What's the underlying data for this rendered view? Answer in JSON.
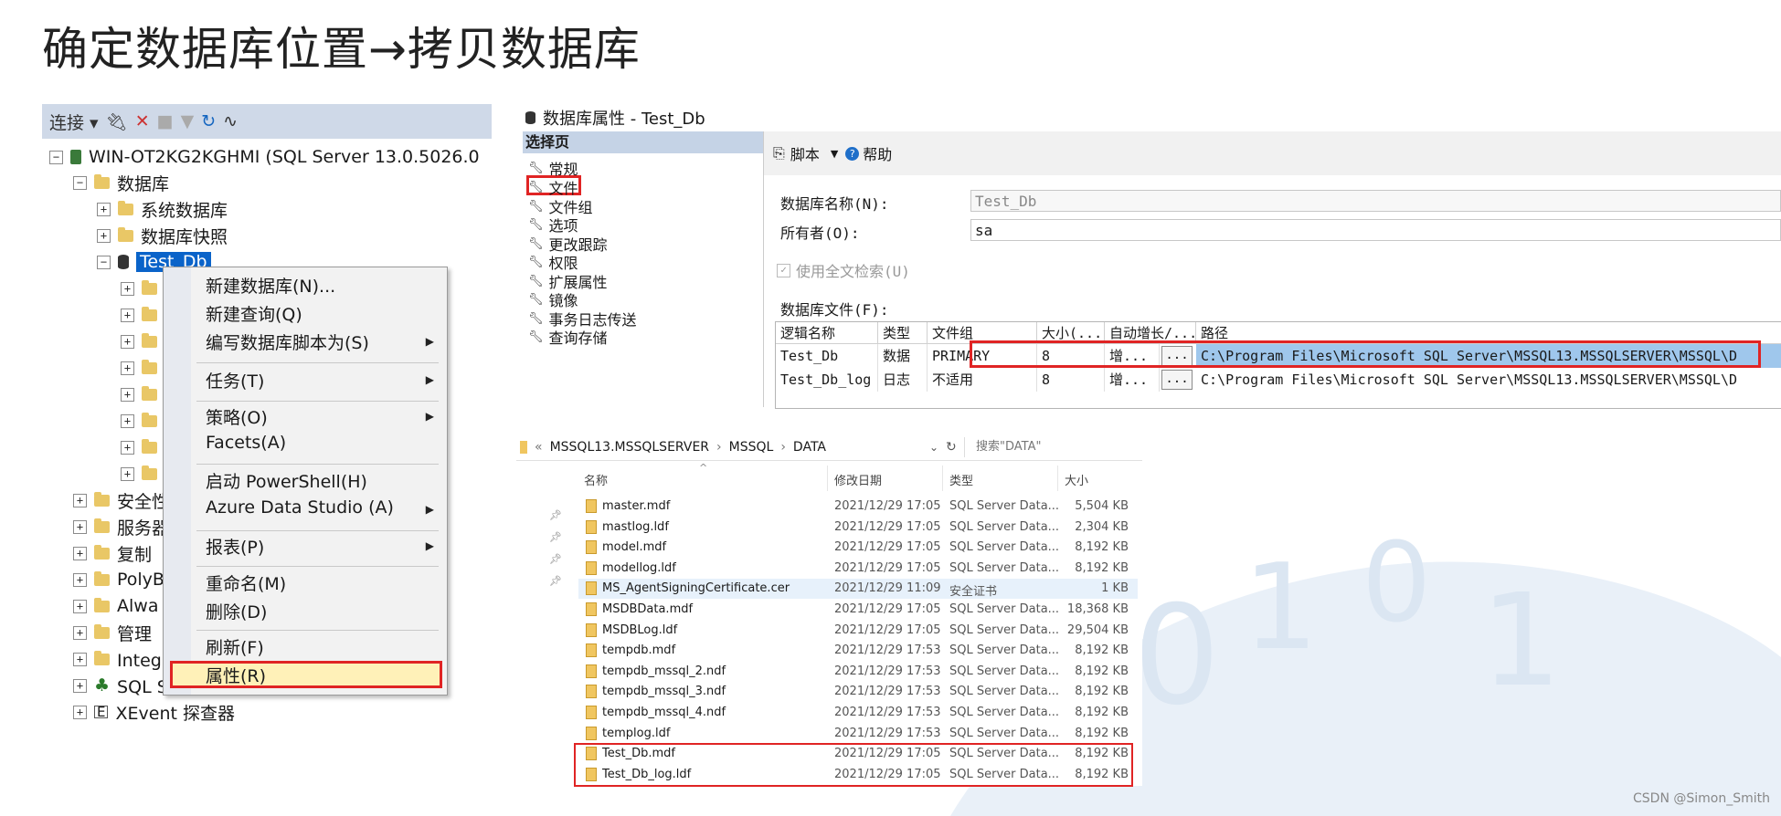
{
  "slide": {
    "title": "确定数据库位置→拷贝数据库",
    "footer": "CSDN @Simon_Smith"
  },
  "object_explorer": {
    "toolbar": {
      "connect_label": "连接 ▾",
      "icons": [
        "plug-icon",
        "disconnect-icon",
        "stop-icon",
        "filter-icon",
        "refresh-icon",
        "activity-icon"
      ]
    },
    "server": "WIN-OT2KG2KGHMI (SQL Server 13.0.5026.0",
    "databases": "数据库",
    "system_databases": "系统数据库",
    "db_snapshots": "数据库快照",
    "test_db": "Test_Db",
    "partial_items": [
      "安全性",
      "服务器",
      "复制",
      "PolyB",
      "Alwa",
      "管理"
    ],
    "integration": "Integration Services 目录",
    "agent": "SQL Server 代理",
    "xevent": "XEvent 探查器"
  },
  "context_menu": {
    "items": [
      {
        "label": "新建数据库(N)...",
        "submenu": false
      },
      {
        "label": "新建查询(Q)",
        "submenu": false
      },
      {
        "label": "编写数据库脚本为(S)",
        "submenu": true
      },
      {
        "label": "任务(T)",
        "submenu": true
      },
      {
        "label": "策略(O)",
        "submenu": true
      },
      {
        "label": "Facets(A)",
        "submenu": false
      },
      {
        "label": "启动 PowerShell(H)",
        "submenu": false
      },
      {
        "label": "Azure Data Studio (A)",
        "submenu": true
      },
      {
        "label": "报表(P)",
        "submenu": true
      },
      {
        "label": "重命名(M)",
        "submenu": false
      },
      {
        "label": "删除(D)",
        "submenu": false
      },
      {
        "label": "刷新(F)",
        "submenu": false
      },
      {
        "label": "属性(R)",
        "submenu": false,
        "highlighted": true
      }
    ]
  },
  "properties_dialog": {
    "title": "数据库属性 - Test_Db",
    "select_page_header": "选择页",
    "pages": [
      "常规",
      "文件",
      "文件组",
      "选项",
      "更改跟踪",
      "权限",
      "扩展属性",
      "镜像",
      "事务日志传送",
      "查询存储"
    ],
    "selected_page": "文件",
    "toolbar": {
      "script": "脚本",
      "help": "帮助"
    },
    "db_name_label": "数据库名称(N):",
    "db_name_value": "Test_Db",
    "owner_label": "所有者(O):",
    "owner_value": "sa",
    "fulltext_label": "使用全文检索(U)",
    "files_label": "数据库文件(F):",
    "grid": {
      "headers": [
        "逻辑名称",
        "类型",
        "文件组",
        "大小(...",
        "自动增长/...",
        "路径"
      ],
      "rows": [
        {
          "name": "Test_Db",
          "type": "数据",
          "filegroup": "PRIMARY",
          "size": "8",
          "growth": "增...",
          "path": "C:\\Program Files\\Microsoft SQL Server\\MSSQL13.MSSQLSERVER\\MSSQL\\D"
        },
        {
          "name": "Test_Db_log",
          "type": "日志",
          "filegroup": "不适用",
          "size": "8",
          "growth": "增...",
          "path": "C:\\Program Files\\Microsoft SQL Server\\MSSQL13.MSSQLSERVER\\MSSQL\\D"
        }
      ]
    }
  },
  "file_explorer": {
    "breadcrumb": [
      "MSSQL13.MSSQLSERVER",
      "MSSQL",
      "DATA"
    ],
    "breadcrumb_prefix": "«",
    "search_placeholder": "搜索\"DATA\"",
    "headers": [
      "名称",
      "修改日期",
      "类型",
      "大小"
    ],
    "files": [
      {
        "name": "master.mdf",
        "date": "2021/12/29 17:05",
        "type": "SQL Server Data...",
        "size": "5,504 KB"
      },
      {
        "name": "mastlog.ldf",
        "date": "2021/12/29 17:05",
        "type": "SQL Server Data...",
        "size": "2,304 KB"
      },
      {
        "name": "model.mdf",
        "date": "2021/12/29 17:05",
        "type": "SQL Server Data...",
        "size": "8,192 KB"
      },
      {
        "name": "modellog.ldf",
        "date": "2021/12/29 17:05",
        "type": "SQL Server Data...",
        "size": "8,192 KB"
      },
      {
        "name": "MS_AgentSigningCertificate.cer",
        "date": "2021/12/29 11:09",
        "type": "安全证书",
        "size": "1 KB"
      },
      {
        "name": "MSDBData.mdf",
        "date": "2021/12/29 17:05",
        "type": "SQL Server Data...",
        "size": "18,368 KB"
      },
      {
        "name": "MSDBLog.ldf",
        "date": "2021/12/29 17:05",
        "type": "SQL Server Data...",
        "size": "29,504 KB"
      },
      {
        "name": "tempdb.mdf",
        "date": "2021/12/29 17:53",
        "type": "SQL Server Data...",
        "size": "8,192 KB"
      },
      {
        "name": "tempdb_mssql_2.ndf",
        "date": "2021/12/29 17:53",
        "type": "SQL Server Data...",
        "size": "8,192 KB"
      },
      {
        "name": "tempdb_mssql_3.ndf",
        "date": "2021/12/29 17:53",
        "type": "SQL Server Data...",
        "size": "8,192 KB"
      },
      {
        "name": "tempdb_mssql_4.ndf",
        "date": "2021/12/29 17:53",
        "type": "SQL Server Data...",
        "size": "8,192 KB"
      },
      {
        "name": "templog.ldf",
        "date": "2021/12/29 17:53",
        "type": "SQL Server Data...",
        "size": "8,192 KB"
      },
      {
        "name": "Test_Db.mdf",
        "date": "2021/12/29 17:05",
        "type": "SQL Server Data...",
        "size": "8,192 KB"
      },
      {
        "name": "Test_Db_log.ldf",
        "date": "2021/12/29 17:05",
        "type": "SQL Server Data...",
        "size": "8,192 KB"
      }
    ]
  },
  "colors": {
    "highlight_red": "#e02424",
    "selection_blue": "#0a63c9",
    "path_highlight": "#9fc7ec"
  }
}
